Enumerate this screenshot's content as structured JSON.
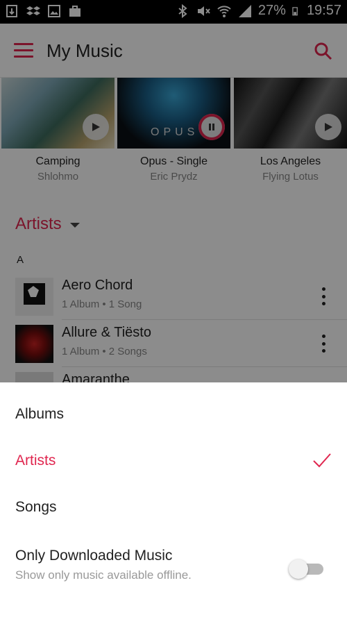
{
  "status_bar": {
    "battery": "27%",
    "time": "19:57",
    "left_icons": [
      "download-icon",
      "dropbox-icon",
      "image-icon",
      "briefcase-icon"
    ],
    "right_icons": [
      "bluetooth-icon",
      "mute-icon",
      "wifi-icon",
      "signal-icon",
      "battery-icon"
    ]
  },
  "app_bar": {
    "title": "My Music"
  },
  "albums": [
    {
      "name": "Camping",
      "artist": "Shlohmo",
      "state": "play"
    },
    {
      "name": "Opus - Single",
      "artist": "Eric Prydz",
      "state": "pause",
      "art_text": "OPUS"
    },
    {
      "name": "Los Angeles",
      "artist": "Flying Lotus",
      "state": "play"
    }
  ],
  "artists_section": {
    "header": "Artists",
    "letter": "A",
    "rows": [
      {
        "name": "Aero Chord",
        "meta": "1 Album  • 1 Song"
      },
      {
        "name": "Allure & Tiësto",
        "meta": "1 Album  • 2 Songs"
      },
      {
        "name": "Amaranthe",
        "meta": ""
      }
    ]
  },
  "sheet": {
    "options": [
      {
        "label": "Albums",
        "selected": false
      },
      {
        "label": "Artists",
        "selected": true
      },
      {
        "label": "Songs",
        "selected": false
      }
    ],
    "downloaded": {
      "label": "Only Downloaded Music",
      "description": "Show only music available offline.",
      "enabled": false
    }
  },
  "colors": {
    "accent": "#e0264f",
    "scrim": "rgba(0,0,0,0.45)"
  }
}
